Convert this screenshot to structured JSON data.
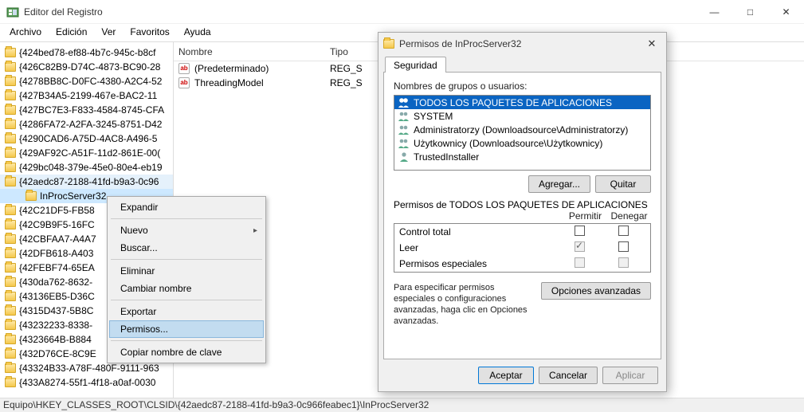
{
  "window": {
    "title": "Editor del Registro",
    "min": "—",
    "max": "□",
    "close": "✕"
  },
  "menu": [
    "Archivo",
    "Edición",
    "Ver",
    "Favoritos",
    "Ayuda"
  ],
  "tree": [
    "{424bed78-ef88-4b7c-945c-b8cf",
    "{426C82B9-D74C-4873-BC90-28",
    "{4278BB8C-D0FC-4380-A2C4-52",
    "{427B34A5-2199-467e-BAC2-11",
    "{427BC7E3-F833-4584-8745-CFA",
    "{4286FA72-A2FA-3245-8751-D42",
    "{4290CAD6-A75D-4AC8-A496-5",
    "{429AF92C-A51F-11d2-861E-00(",
    "{429bc048-379e-45e0-80e4-eb19",
    "{42aedc87-2188-41fd-b9a3-0c96"
  ],
  "tree_child": "InProcServer32",
  "tree_after": [
    "{42C21DF5-FB58",
    "{42C9B9F5-16FC",
    "{42CBFAA7-A4A7",
    "{42DFB618-A403",
    "{42FEBF74-65EA",
    "{430da762-8632-",
    "{43136EB5-D36C",
    "{4315D437-5B8C",
    "{43232233-8338-",
    "{4323664B-B884",
    "{432D76CE-8C9E",
    "{43324B33-A78F-480F-9111-963",
    "{433A8274-55f1-4f18-a0af-0030"
  ],
  "listview": {
    "col_name": "Nombre",
    "col_type": "Tipo",
    "rows": [
      {
        "name": "(Predeterminado)",
        "type": "REG_S"
      },
      {
        "name": "ThreadingModel",
        "type": "REG_S"
      }
    ]
  },
  "status": "Equipo\\HKEY_CLASSES_ROOT\\CLSID\\{42aedc87-2188-41fd-b9a3-0c966feabec1}\\InProcServer32",
  "ctx": {
    "expand": "Expandir",
    "new": "Nuevo",
    "find": "Buscar...",
    "delete": "Eliminar",
    "rename": "Cambiar nombre",
    "export": "Exportar",
    "perms": "Permisos...",
    "copy": "Copiar nombre de clave"
  },
  "dialog": {
    "title": "Permisos de InProcServer32",
    "tab": "Seguridad",
    "groups_label": "Nombres de grupos o usuarios:",
    "users": [
      "TODOS LOS PAQUETES DE APLICACIONES",
      "SYSTEM",
      "Administratorzy (Downloadsource\\Administratorzy)",
      "Użytkownicy (Downloadsource\\Użytkownicy)",
      "TrustedInstaller"
    ],
    "add": "Agregar...",
    "remove": "Quitar",
    "perms_for": "Permisos de TODOS LOS PAQUETES DE APLICACIONES",
    "allow": "Permitir",
    "deny": "Denegar",
    "perm_rows": [
      "Control total",
      "Leer",
      "Permisos especiales"
    ],
    "adv_text": "Para especificar permisos especiales o configuraciones avanzadas, haga clic en Opciones avanzadas.",
    "adv_btn": "Opciones avanzadas",
    "ok": "Aceptar",
    "cancel": "Cancelar",
    "apply": "Aplicar"
  }
}
